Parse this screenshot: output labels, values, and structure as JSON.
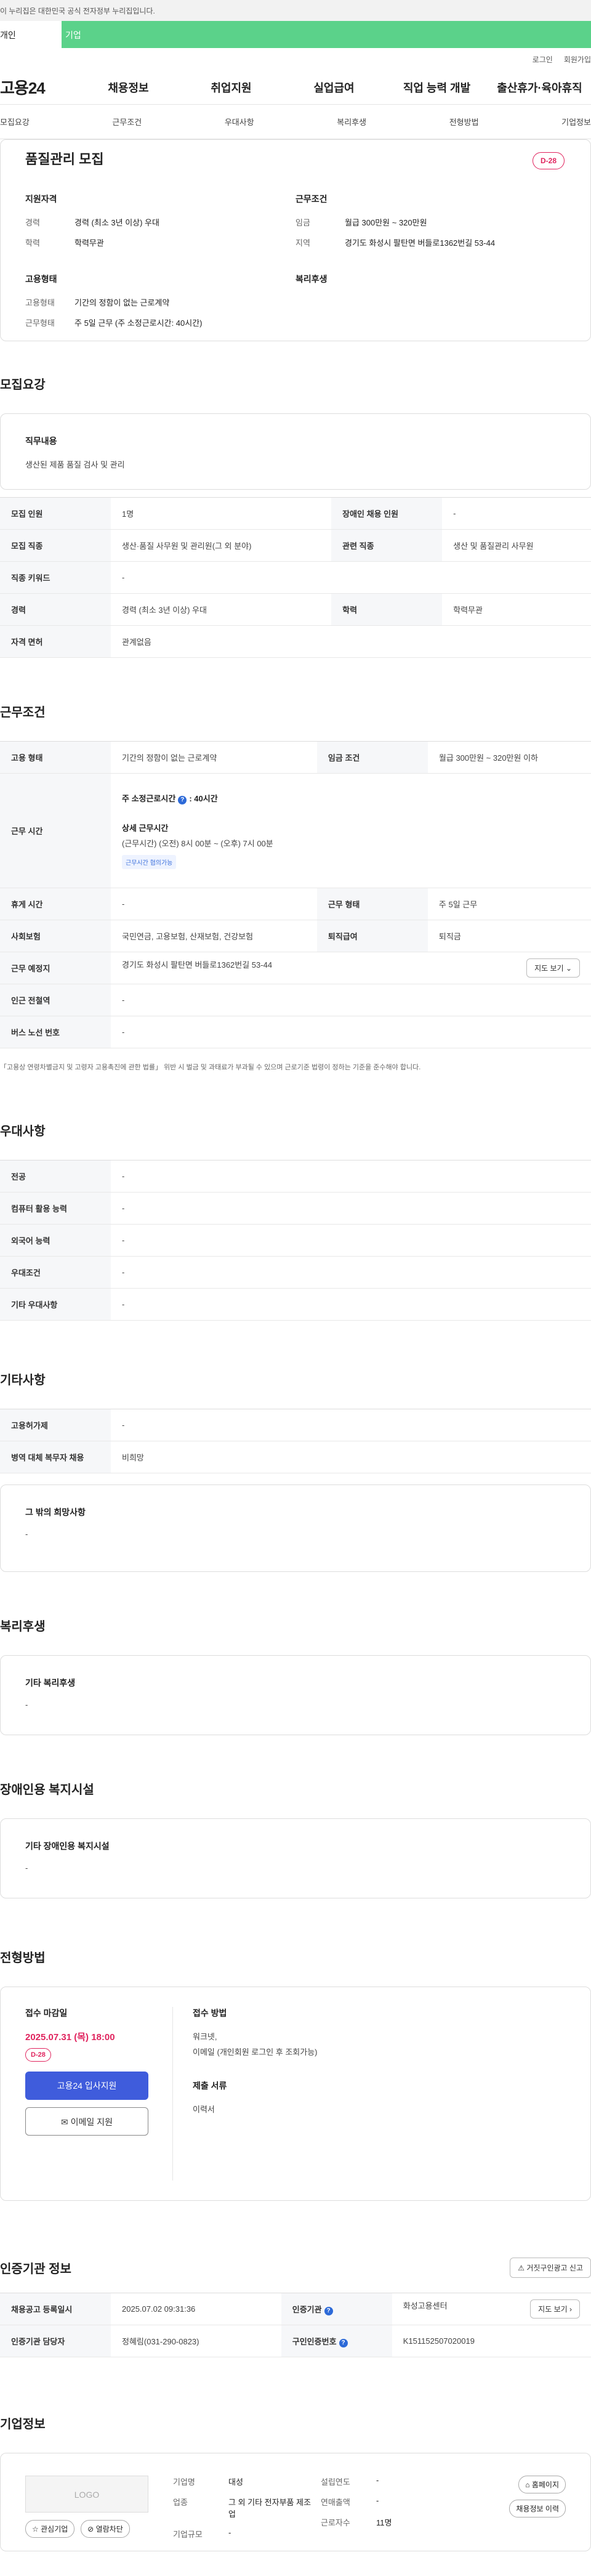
{
  "gov_banner": "이 누리집은 대한민국 공식 전자정부 누리집입니다.",
  "tabs": {
    "person": "개인",
    "corp": "기업"
  },
  "util": [
    "로그인",
    "회원가입"
  ],
  "logo": "고용24",
  "gnb": [
    "채용정보",
    "취업지원",
    "실업급여",
    "직업 능력 개발",
    "출산휴가·육아휴직"
  ],
  "anchor_nav": [
    "모집요강",
    "근무조건",
    "우대사항",
    "복리후생",
    "전형방법",
    "기업정보"
  ],
  "summary": {
    "title": "품질관리 모집",
    "dday": "D-28",
    "qual_h": "지원자격",
    "qual": [
      {
        "k": "경력",
        "v": "경력 (최소 3년 이상) 우대"
      },
      {
        "k": "학력",
        "v": "학력무관"
      }
    ],
    "work_h": "근무조건",
    "work": [
      {
        "k": "임금",
        "v": "월급 300만원 ~ 320만원"
      },
      {
        "k": "지역",
        "v": "경기도 화성시 팔탄면 버들로1362번길 53-44"
      }
    ],
    "emp_h": "고용형태",
    "emp": [
      {
        "k": "고용형태",
        "v": "기간의 정함이 없는 근로계약"
      },
      {
        "k": "근무형태",
        "v": "주 5일 근무 (주 소정근로시간: 40시간)"
      }
    ],
    "welfare_h": "복리후생"
  },
  "recruit": {
    "title": "모집요강",
    "duty_h": "직무내용",
    "duty_v": "생산된 제품 품질 검사 및 관리",
    "rows": [
      {
        "k1": "모집 인원",
        "v1": "1명",
        "k2": "장애인 채용 인원",
        "v2": "-"
      },
      {
        "k1": "모집 직종",
        "v1": "생산·품질 사무원 및 관리원(그 외 분야)",
        "k2": "관련 직종",
        "v2": "생산 및 품질관리 사무원"
      },
      {
        "k1": "직종 키워드",
        "v1": "-"
      },
      {
        "k1": "경력",
        "v1": "경력 (최소 3년 이상) 우대",
        "k2": "학력",
        "v2": "학력무관"
      },
      {
        "k1": "자격 면허",
        "v1": "관계없음"
      }
    ]
  },
  "work_cond": {
    "title": "근무조건",
    "emp_k": "고용 형태",
    "emp_v": "기간의 정함이 없는 근로계약",
    "wage_k": "임금 조건",
    "wage_v": "월급 300만원 ~ 320만원 이하",
    "hours_k": "근무 시간",
    "hours_main": "주 소정근로시간",
    "hours_main_v": ": 40시간",
    "hours_detail_h": "상세 근무시간",
    "hours_detail_v": "(근무시간) (오전) 8시 00분 ~ (오후) 7시 00분",
    "hours_tag": "근무시간 협의가능",
    "rest_k": "휴게 시간",
    "rest_v": "-",
    "type_k": "근무 형태",
    "type_v": "주 5일 근무",
    "ins_k": "사회보험",
    "ins_v": "국민연금, 고용보험, 산재보험, 건강보험",
    "ret_k": "퇴직급여",
    "ret_v": "퇴직금",
    "place_k": "근무 예정지",
    "place_v": "경기도 화성시 팔탄면 버들로1362번길 53-44",
    "map_btn": "지도 보기",
    "station_k": "인근 전철역",
    "station_v": "-",
    "bus_k": "버스 노선 번호",
    "bus_v": "-",
    "note": "「고용상 연령차별금지 및 고령자 고용촉진에 관한 법률」 위반 시 벌금 및 과태료가 부과될 수 있으며 근로기준 법령이 정하는 기준을 준수해야 합니다."
  },
  "preference": {
    "title": "우대사항",
    "rows": [
      {
        "k": "전공",
        "v": "-"
      },
      {
        "k": "컴퓨터 활용 능력",
        "v": "-"
      },
      {
        "k": "외국어 능력",
        "v": "-"
      },
      {
        "k": "우대조건",
        "v": "-"
      },
      {
        "k": "기타 우대사항",
        "v": "-"
      }
    ]
  },
  "etc": {
    "title": "기타사항",
    "rows": [
      {
        "k": "고용허가제",
        "v": "-"
      },
      {
        "k": "병역 대체 복무자 채용",
        "v": "비희망"
      }
    ],
    "other_h": "그 밖의 희망사항",
    "other_v": "-"
  },
  "welfare": {
    "title": "복리후생",
    "h": "기타 복리후생",
    "v": "-"
  },
  "disabled": {
    "title": "장애인용 복지시설",
    "h": "기타 장애인용 복지시설",
    "v": "-"
  },
  "screening": {
    "title": "전형방법",
    "deadline_h": "접수 마감일",
    "deadline_v": "2025.07.31 (목) 18:00",
    "dday": "D-28",
    "apply_btn": "고용24 입사지원",
    "email_btn": "이메일 지원",
    "method_h": "접수 방법",
    "method_v1": "워크넷,",
    "method_v2": "이메일 (개인회원 로그인 후 조회가능)",
    "docs_h": "제출 서류",
    "docs_v": "이력서"
  },
  "cert": {
    "title": "인증기관 정보",
    "report_btn": "거짓구인광고 신고",
    "reg_k": "채용공고 등록일시",
    "reg_v": "2025.07.02 09:31:36",
    "agency_k": "인증기관",
    "agency_v": "화성고용센터",
    "map_btn": "지도 보기",
    "manager_k": "인증기관 담당자",
    "manager_v": "정혜림(031-290-0823)",
    "cert_no_k": "구인인증번호",
    "cert_no_v": "K151152507020019"
  },
  "corp": {
    "title": "기업정보",
    "logo": "LOGO",
    "fav_btn": "관심기업",
    "block_btn": "열람차단",
    "name_k": "기업명",
    "name_v": "대성",
    "ind_k": "업종",
    "ind_v": "그 외 기타 전자부품 제조업",
    "size_k": "기업규모",
    "size_v": "-",
    "year_k": "설립연도",
    "year_v": "-",
    "sales_k": "연매출액",
    "sales_v": "-",
    "staff_k": "근로자수",
    "staff_v": "11명",
    "home_btn": "홈페이지",
    "hist_btn": "채용정보 이력"
  }
}
